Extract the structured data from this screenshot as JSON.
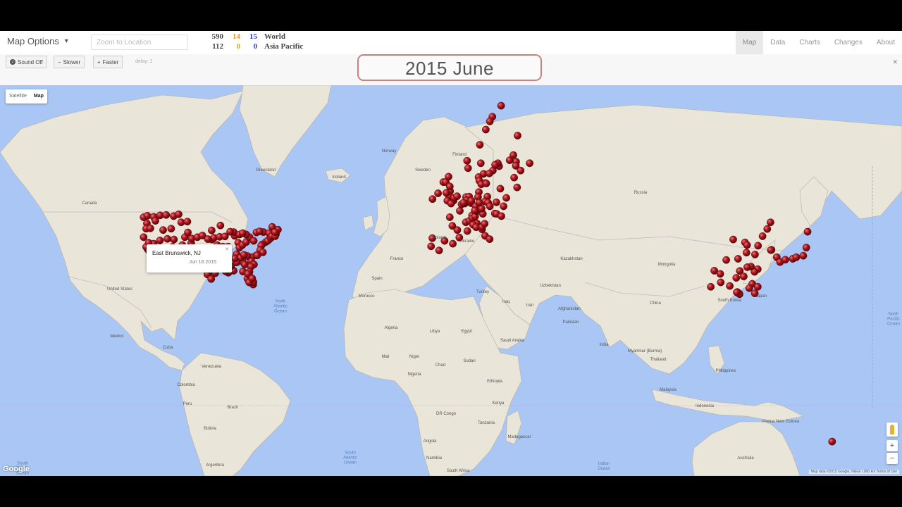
{
  "topbar": {
    "map_options_label": "Map Options",
    "zoom_placeholder": "Zoom to Location",
    "stats": [
      {
        "total": "590",
        "mid": "14",
        "new": "15",
        "region": "World"
      },
      {
        "total": "112",
        "mid": "0",
        "new": "0",
        "region": "Asia Pacific"
      }
    ],
    "nav": [
      "Map",
      "Data",
      "Charts",
      "Changes",
      "About"
    ],
    "active_nav": "Map"
  },
  "controls": {
    "sound_label": "Sound Off",
    "slower_label": "Slower",
    "faster_label": "Faster",
    "delay_label": "delay: 1",
    "date": "2015 June",
    "close_icon": "close-icon"
  },
  "map": {
    "type_satellite": "Satellite",
    "type_map": "Map",
    "info_window": {
      "title": "East Brunswick, NJ",
      "date": "Jun 16 2015"
    },
    "google_logo": "Google",
    "attribution": "Map data ©2015 Google, INEGI   1000 km   Terms of Use",
    "countries": [
      "Greenland",
      "Iceland",
      "Canada",
      "Russia",
      "Norway",
      "Sweden",
      "Finland",
      "Poland",
      "Ukraine",
      "Kazakhstan",
      "Mongolia",
      "China",
      "Turkey",
      "Iran",
      "Iraq",
      "Algeria",
      "Libya",
      "Egypt",
      "Mali",
      "Niger",
      "Chad",
      "Sudan",
      "Ethiopia",
      "Nigeria",
      "Saudi Arabia",
      "Pakistan",
      "India",
      "Afghanistan",
      "Uzbekistan",
      "Mexico",
      "Colombia",
      "Brazil",
      "Peru",
      "Bolivia",
      "Argentina",
      "DR Congo",
      "Angola",
      "Kenya",
      "Tanzania",
      "Namibia",
      "South Africa",
      "Madagascar",
      "Indonesia",
      "Malaysia",
      "Thailand",
      "Myanmar (Burma)",
      "Philippines",
      "Papua New Guinea",
      "Australia",
      "South Korea",
      "Japan",
      "France",
      "Spain",
      "United States",
      "Venezuela",
      "Morocco",
      "Cuba"
    ],
    "oceans": [
      {
        "name": "North\nAtlantic\nOcean"
      },
      {
        "name": "South\nAtlantic\nOcean"
      },
      {
        "name": "Indian\nOcean"
      },
      {
        "name": "North\nPacific\nOcean"
      },
      {
        "name": "South\nPacific\nOcean"
      }
    ],
    "pin_color": "#a8141a",
    "pins": [
      [
        -124.0,
        47.2
      ],
      [
        -122.5,
        47.6
      ],
      [
        -120.0,
        47.3
      ],
      [
        -117.4,
        47.7
      ],
      [
        -115.0,
        47.8
      ],
      [
        -112.0,
        47.5
      ],
      [
        -110.0,
        48.0
      ],
      [
        -122.7,
        45.5
      ],
      [
        -119.3,
        46.2
      ],
      [
        -116.2,
        43.6
      ],
      [
        -123.0,
        44.0
      ],
      [
        -121.3,
        44.1
      ],
      [
        -113.0,
        44.0
      ],
      [
        -109.0,
        45.8
      ],
      [
        -106.5,
        46.0
      ],
      [
        -124.0,
        41.5
      ],
      [
        -122.4,
        37.8
      ],
      [
        -121.9,
        37.3
      ],
      [
        -121.5,
        38.6
      ],
      [
        -120.0,
        39.5
      ],
      [
        -119.8,
        36.7
      ],
      [
        -118.2,
        34.1
      ],
      [
        -117.2,
        32.7
      ],
      [
        -116.5,
        33.8
      ],
      [
        -115.1,
        36.2
      ],
      [
        -119.0,
        35.4
      ],
      [
        -120.7,
        35.3
      ],
      [
        -117.9,
        33.7
      ],
      [
        -114.0,
        35.2
      ],
      [
        -112.1,
        33.5
      ],
      [
        -110.9,
        32.2
      ],
      [
        -111.9,
        40.8
      ],
      [
        -112.5,
        38.5
      ],
      [
        -114.5,
        41.0
      ],
      [
        -117.5,
        40.5
      ],
      [
        -123.0,
        38.5
      ],
      [
        -122.0,
        39.8
      ],
      [
        -118.5,
        37.5
      ],
      [
        -116.8,
        36.0
      ],
      [
        -106.6,
        35.1
      ],
      [
        -105.0,
        39.7
      ],
      [
        -104.8,
        38.8
      ],
      [
        -106.0,
        37.2
      ],
      [
        -108.5,
        39.1
      ],
      [
        -107.5,
        41.5
      ],
      [
        -104.8,
        41.1
      ],
      [
        -106.3,
        42.9
      ],
      [
        -102.5,
        41.5
      ],
      [
        -100.5,
        42.0
      ],
      [
        -97.5,
        35.5
      ],
      [
        -96.8,
        32.8
      ],
      [
        -97.7,
        30.3
      ],
      [
        -95.4,
        29.8
      ],
      [
        -98.5,
        29.4
      ],
      [
        -101.8,
        35.2
      ],
      [
        -99.7,
        32.4
      ],
      [
        -94.7,
        32.5
      ],
      [
        -97.0,
        27.8
      ],
      [
        -106.4,
        31.8
      ],
      [
        -102.1,
        31.9
      ],
      [
        -100.5,
        31.4
      ],
      [
        -96.7,
        40.8
      ],
      [
        -95.9,
        41.3
      ],
      [
        -97.3,
        37.7
      ],
      [
        -94.6,
        39.1
      ],
      [
        -92.3,
        38.6
      ],
      [
        -90.2,
        38.6
      ],
      [
        -93.6,
        41.6
      ],
      [
        -93.3,
        44.9
      ],
      [
        -91.5,
        41.7
      ],
      [
        -96.8,
        43.5
      ],
      [
        -98.3,
        40.9
      ],
      [
        -95.7,
        37.2
      ],
      [
        -87.6,
        41.9
      ],
      [
        -88.0,
        43.0
      ],
      [
        -89.4,
        43.1
      ],
      [
        -86.2,
        39.8
      ],
      [
        -85.7,
        38.3
      ],
      [
        -84.5,
        39.1
      ],
      [
        -83.0,
        40.0
      ],
      [
        -81.7,
        41.5
      ],
      [
        -83.0,
        42.3
      ],
      [
        -85.6,
        42.3
      ],
      [
        -84.4,
        42.7
      ],
      [
        -80.0,
        40.4
      ],
      [
        -78.9,
        42.9
      ],
      [
        -76.1,
        43.0
      ],
      [
        -77.6,
        43.2
      ],
      [
        -73.8,
        42.7
      ],
      [
        -75.2,
        40.0
      ],
      [
        -74.0,
        40.7
      ],
      [
        -74.4,
        40.4
      ],
      [
        -73.2,
        41.2
      ],
      [
        -72.7,
        41.8
      ],
      [
        -71.1,
        42.4
      ],
      [
        -71.4,
        41.8
      ],
      [
        -70.3,
        43.7
      ],
      [
        -72.6,
        44.5
      ],
      [
        -71.5,
        43.0
      ],
      [
        -76.6,
        39.3
      ],
      [
        -77.0,
        38.9
      ],
      [
        -77.4,
        37.5
      ],
      [
        -76.3,
        36.8
      ],
      [
        -79.0,
        35.8
      ],
      [
        -80.8,
        35.2
      ],
      [
        -78.6,
        35.8
      ],
      [
        -81.0,
        34.0
      ],
      [
        -79.9,
        32.8
      ],
      [
        -84.4,
        33.7
      ],
      [
        -83.6,
        32.8
      ],
      [
        -81.1,
        32.1
      ],
      [
        -82.5,
        35.6
      ],
      [
        -86.8,
        36.2
      ],
      [
        -90.0,
        35.1
      ],
      [
        -85.3,
        35.0
      ],
      [
        -83.9,
        36.0
      ],
      [
        -86.8,
        33.5
      ],
      [
        -88.0,
        30.7
      ],
      [
        -90.1,
        30.0
      ],
      [
        -91.1,
        30.4
      ],
      [
        -92.0,
        32.5
      ],
      [
        -89.0,
        32.3
      ],
      [
        -93.8,
        32.5
      ],
      [
        -92.3,
        34.7
      ],
      [
        -94.2,
        36.1
      ],
      [
        -87.6,
        34.8
      ],
      [
        -81.7,
        30.3
      ],
      [
        -82.5,
        27.9
      ],
      [
        -81.4,
        28.5
      ],
      [
        -80.2,
        25.8
      ],
      [
        -80.1,
        26.7
      ],
      [
        -84.3,
        30.4
      ],
      [
        -82.3,
        29.6
      ],
      [
        -81.8,
        26.6
      ],
      [
        -80.6,
        28.0
      ],
      [
        -6.3,
        53.3
      ],
      [
        -8.5,
        51.9
      ],
      [
        -4.2,
        55.9
      ],
      [
        -3.2,
        55.9
      ],
      [
        -2.2,
        53.5
      ],
      [
        -1.5,
        53.8
      ],
      [
        -1.9,
        52.5
      ],
      [
        -0.1,
        51.5
      ],
      [
        -2.6,
        51.5
      ],
      [
        -1.1,
        50.8
      ],
      [
        0.1,
        52.2
      ],
      [
        1.3,
        52.6
      ],
      [
        -3.0,
        53.4
      ],
      [
        -1.6,
        54.9
      ],
      [
        -2.1,
        57.1
      ],
      [
        2.4,
        48.9
      ],
      [
        4.8,
        45.8
      ],
      [
        5.4,
        43.3
      ],
      [
        1.4,
        43.6
      ],
      [
        -0.6,
        44.8
      ],
      [
        -1.6,
        47.2
      ],
      [
        3.1,
        50.6
      ],
      [
        7.3,
        47.7
      ],
      [
        6.2,
        46.2
      ],
      [
        7.4,
        46.9
      ],
      [
        8.5,
        47.4
      ],
      [
        4.4,
        50.8
      ],
      [
        4.9,
        52.4
      ],
      [
        6.1,
        52.5
      ],
      [
        5.1,
        51.6
      ],
      [
        3.9,
        51.0
      ],
      [
        6.9,
        50.9
      ],
      [
        6.8,
        51.2
      ],
      [
        7.0,
        51.5
      ],
      [
        8.7,
        50.1
      ],
      [
        9.2,
        48.8
      ],
      [
        11.6,
        48.1
      ],
      [
        13.4,
        52.5
      ],
      [
        10.0,
        53.6
      ],
      [
        9.7,
        52.4
      ],
      [
        12.4,
        51.3
      ],
      [
        13.7,
        51.0
      ],
      [
        11.1,
        49.5
      ],
      [
        8.4,
        49.0
      ],
      [
        10.2,
        51.0
      ],
      [
        14.4,
        50.1
      ],
      [
        16.4,
        48.2
      ],
      [
        17.1,
        48.1
      ],
      [
        19.0,
        47.5
      ],
      [
        21.0,
        52.2
      ],
      [
        19.9,
        50.1
      ],
      [
        17.0,
        51.1
      ],
      [
        18.6,
        54.4
      ],
      [
        12.6,
        55.7
      ],
      [
        9.9,
        57.0
      ],
      [
        10.2,
        56.2
      ],
      [
        11.0,
        55.4
      ],
      [
        9.2,
        45.5
      ],
      [
        7.7,
        45.1
      ],
      [
        8.9,
        44.4
      ],
      [
        11.3,
        43.8
      ],
      [
        11.3,
        44.5
      ],
      [
        12.3,
        45.4
      ],
      [
        12.5,
        41.9
      ],
      [
        14.3,
        40.9
      ],
      [
        2.2,
        41.4
      ],
      [
        -3.7,
        40.4
      ],
      [
        -0.4,
        39.5
      ],
      [
        -8.6,
        41.2
      ],
      [
        -9.1,
        38.7
      ],
      [
        -5.9,
        37.4
      ],
      [
        10.8,
        59.9
      ],
      [
        5.3,
        60.4
      ],
      [
        5.7,
        58.9
      ],
      [
        10.4,
        63.4
      ],
      [
        11.9,
        57.7
      ],
      [
        13.0,
        55.6
      ],
      [
        18.1,
        59.3
      ],
      [
        15.6,
        58.4
      ],
      [
        17.6,
        59.9
      ],
      [
        16.5,
        59.6
      ],
      [
        14.2,
        57.8
      ],
      [
        24.9,
        60.2
      ],
      [
        22.3,
        60.5
      ],
      [
        23.8,
        61.5
      ],
      [
        25.5,
        65.0
      ],
      [
        18.9,
        69.6
      ],
      [
        15.4,
        68.0
      ],
      [
        14.4,
        67.3
      ],
      [
        12.8,
        66.0
      ],
      [
        24.1,
        56.9
      ],
      [
        25.3,
        54.7
      ],
      [
        24.8,
        59.4
      ],
      [
        30.3,
        59.9
      ],
      [
        26.7,
        58.4
      ],
      [
        116.4,
        39.9
      ],
      [
        117.2,
        39.1
      ],
      [
        121.5,
        31.2
      ],
      [
        120.2,
        30.3
      ],
      [
        118.8,
        32.1
      ],
      [
        114.3,
        30.6
      ],
      [
        113.3,
        23.1
      ],
      [
        114.1,
        22.5
      ],
      [
        114.2,
        22.3
      ],
      [
        104.1,
        30.7
      ],
      [
        106.5,
        29.6
      ],
      [
        108.9,
        34.3
      ],
      [
        113.6,
        34.7
      ],
      [
        112.9,
        28.2
      ],
      [
        117.3,
        31.9
      ],
      [
        119.3,
        26.1
      ],
      [
        118.1,
        24.5
      ],
      [
        120.4,
        36.1
      ],
      [
        117.0,
        36.7
      ],
      [
        123.4,
        41.8
      ],
      [
        121.6,
        38.9
      ],
      [
        125.3,
        43.9
      ],
      [
        126.6,
        45.8
      ],
      [
        111.7,
        40.8
      ],
      [
        102.7,
        25.0
      ],
      [
        110.3,
        25.3
      ],
      [
        106.7,
        26.6
      ],
      [
        115.9,
        28.7
      ],
      [
        113.1,
        23.0
      ],
      [
        121.5,
        25.0
      ],
      [
        120.3,
        22.6
      ],
      [
        127.0,
        37.6
      ],
      [
        129.1,
        35.2
      ],
      [
        126.7,
        37.5
      ],
      [
        139.7,
        35.7
      ],
      [
        135.5,
        34.7
      ],
      [
        136.9,
        35.2
      ],
      [
        130.4,
        33.6
      ],
      [
        141.4,
        43.1
      ],
      [
        132.5,
        34.4
      ],
      [
        140.9,
        38.3
      ],
      [
        151.2,
        -33.9
      ]
    ]
  }
}
